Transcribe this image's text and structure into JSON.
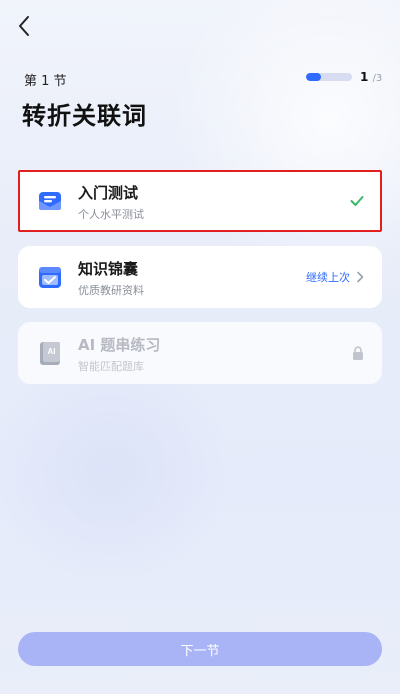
{
  "header": {
    "section_label": "第 1 节",
    "progress_current": "1",
    "progress_total": "/3",
    "progress_fraction": 0.33,
    "lesson_title": "转折关联词"
  },
  "cards": [
    {
      "title": "入门测试",
      "subtitle": "个人水平测试",
      "state": "completed",
      "icon": "mail-icon"
    },
    {
      "title": "知识锦囊",
      "subtitle": "优质教研资料",
      "state": "continue",
      "action_label": "继续上次",
      "icon": "calendar-book-icon"
    },
    {
      "title": "AI 题串练习",
      "subtitle": "智能匹配题库",
      "state": "locked",
      "icon": "ai-book-icon"
    }
  ],
  "footer": {
    "next_label": "下一节"
  },
  "colors": {
    "accent": "#2f6bff",
    "check": "#3cb86a",
    "button": "#a8b4f5",
    "highlight_border": "#e21f1f"
  }
}
